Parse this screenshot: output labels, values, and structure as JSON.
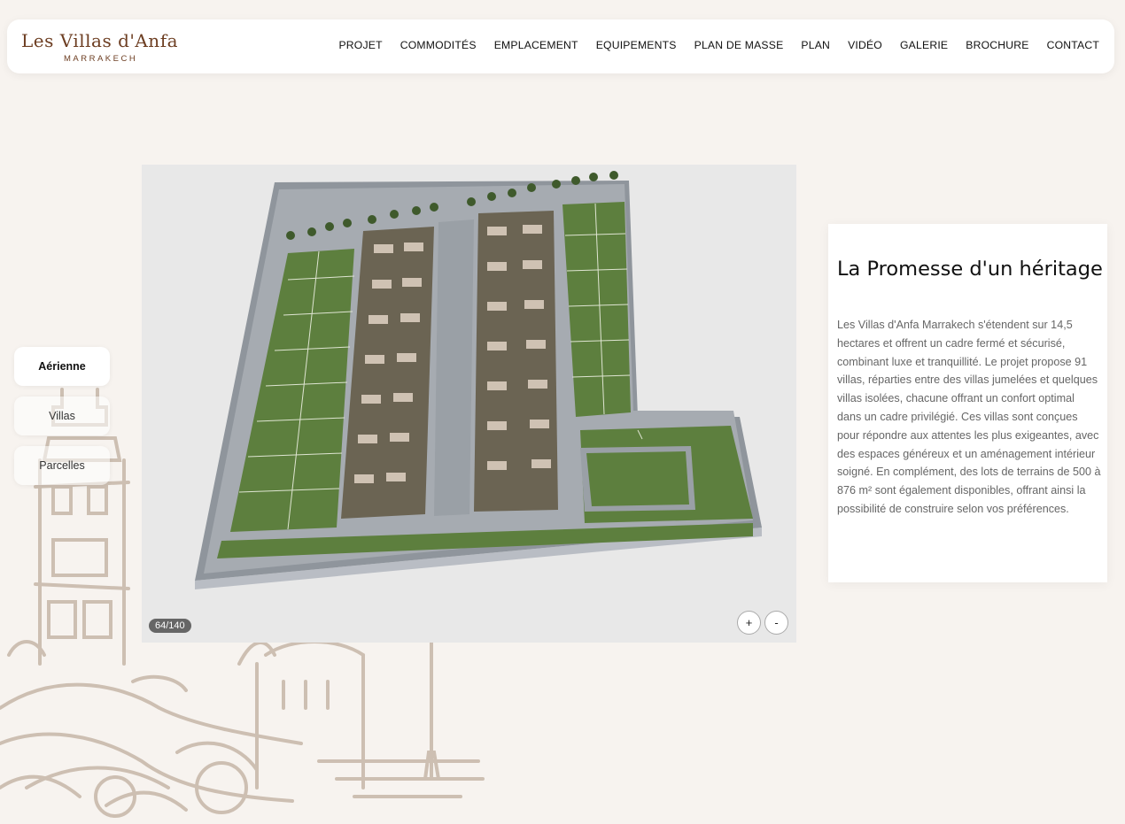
{
  "brand": {
    "name": "Les Villas d'Anfa",
    "city": "MARRAKECH"
  },
  "nav": [
    "PROJET",
    "COMMODITÉS",
    "EMPLACEMENT",
    "EQUIPEMENTS",
    "PLAN DE MASSE",
    "PLAN",
    "VIDÉO",
    "GALERIE",
    "BROCHURE",
    "CONTACT"
  ],
  "view_tabs": [
    {
      "label": "Aérienne",
      "active": true
    },
    {
      "label": "Villas",
      "active": false
    },
    {
      "label": "Parcelles",
      "active": false
    }
  ],
  "viewer": {
    "counter": "64/140",
    "zoom_in": "+",
    "zoom_out": "-"
  },
  "info": {
    "title": "La Promesse d'un héritage",
    "body": "Les Villas d'Anfa Marrakech s'étendent sur 14,5 hectares et offrent un cadre fermé et sécurisé, combinant luxe et tranquillité. Le projet propose 91 villas, réparties entre des villas jumelées et quelques villas isolées, chacune offrant un confort optimal dans un cadre privilégié. Ces villas sont conçues pour répondre aux attentes les plus exigeantes, avec des espaces généreux et un aménagement intérieur soigné. En complément, des lots de terrains de 500 à 876 m² sont également disponibles, offrant ainsi la possibilité de construire selon vos préférences."
  },
  "colors": {
    "brand": "#6d3e22",
    "background": "#f7f3ef",
    "sketch": "#cdbfb2"
  }
}
